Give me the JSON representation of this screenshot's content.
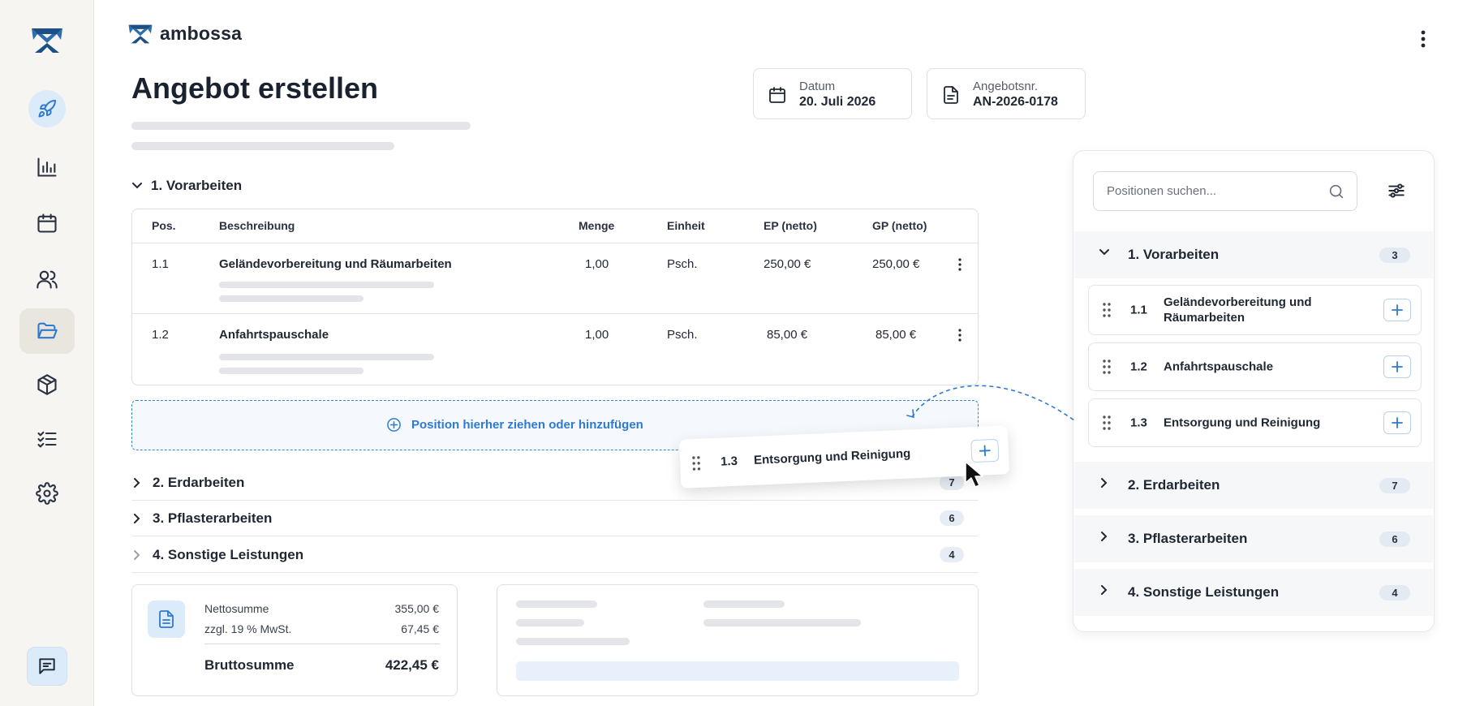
{
  "brand": {
    "name": "ambossa"
  },
  "page": {
    "title": "Angebot erstellen"
  },
  "info": {
    "date_label": "Datum",
    "date_value": "20. Juli 2026",
    "offer_label": "Angebotsnr.",
    "offer_value": "AN-2026-0178"
  },
  "sidebar": {
    "icons": [
      "rocket-icon",
      "chart-icon",
      "calendar-icon",
      "users-icon",
      "folder-icon",
      "box-icon",
      "checklist-icon",
      "gear-icon",
      "chat-icon"
    ],
    "active": "folder-icon",
    "accent": "#2f7ad0"
  },
  "section1": {
    "label": "1. Vorarbeiten"
  },
  "table": {
    "headers": [
      "Pos.",
      "Beschreibung",
      "Menge",
      "Einheit",
      "EP (netto)",
      "GP (netto)"
    ],
    "rows": [
      {
        "pos": "1.1",
        "desc": "Geländevorbereitung und Räumarbeiten",
        "menge": "1,00",
        "einheit": "Psch.",
        "ep": "250,00 €",
        "gp": "250,00 €"
      },
      {
        "pos": "1.2",
        "desc": "Anfahrtspauschale",
        "menge": "1,00",
        "einheit": "Psch.",
        "ep": "85,00 €",
        "gp": "85,00 €"
      }
    ]
  },
  "dropzone": {
    "text": "Position hierher ziehen oder hinzufügen"
  },
  "groups": [
    {
      "label": "2. Erdarbeiten",
      "count": "7"
    },
    {
      "label": "3. Pflasterarbeiten",
      "count": "6"
    },
    {
      "label": "4. Sonstige Leistungen",
      "count": "4"
    }
  ],
  "summary": {
    "net_label": "Nettosumme",
    "net_value": "355,00 €",
    "vat_label": "zzgl. 19 % MwSt.",
    "vat_value": "67,45 €",
    "gross_label": "Bruttosumme",
    "gross_value": "422,45 €"
  },
  "dragged": {
    "pos": "1.3",
    "label": "Entsorgung und Reinigung"
  },
  "panel": {
    "search_placeholder": "Positionen suchen...",
    "group1": {
      "label": "1. Vorarbeiten",
      "count": "3"
    },
    "items": [
      {
        "pos": "1.1",
        "label": "Geländevorbereitung und Räumarbeiten"
      },
      {
        "pos": "1.2",
        "label": "Anfahrtspauschale"
      },
      {
        "pos": "1.3",
        "label": "Entsorgung und Reinigung"
      }
    ],
    "groups": [
      {
        "label": "2. Erdarbeiten",
        "count": "7"
      },
      {
        "label": "3. Pflasterarbeiten",
        "count": "6"
      },
      {
        "label": "4. Sonstige Leistungen",
        "count": "4"
      }
    ]
  }
}
